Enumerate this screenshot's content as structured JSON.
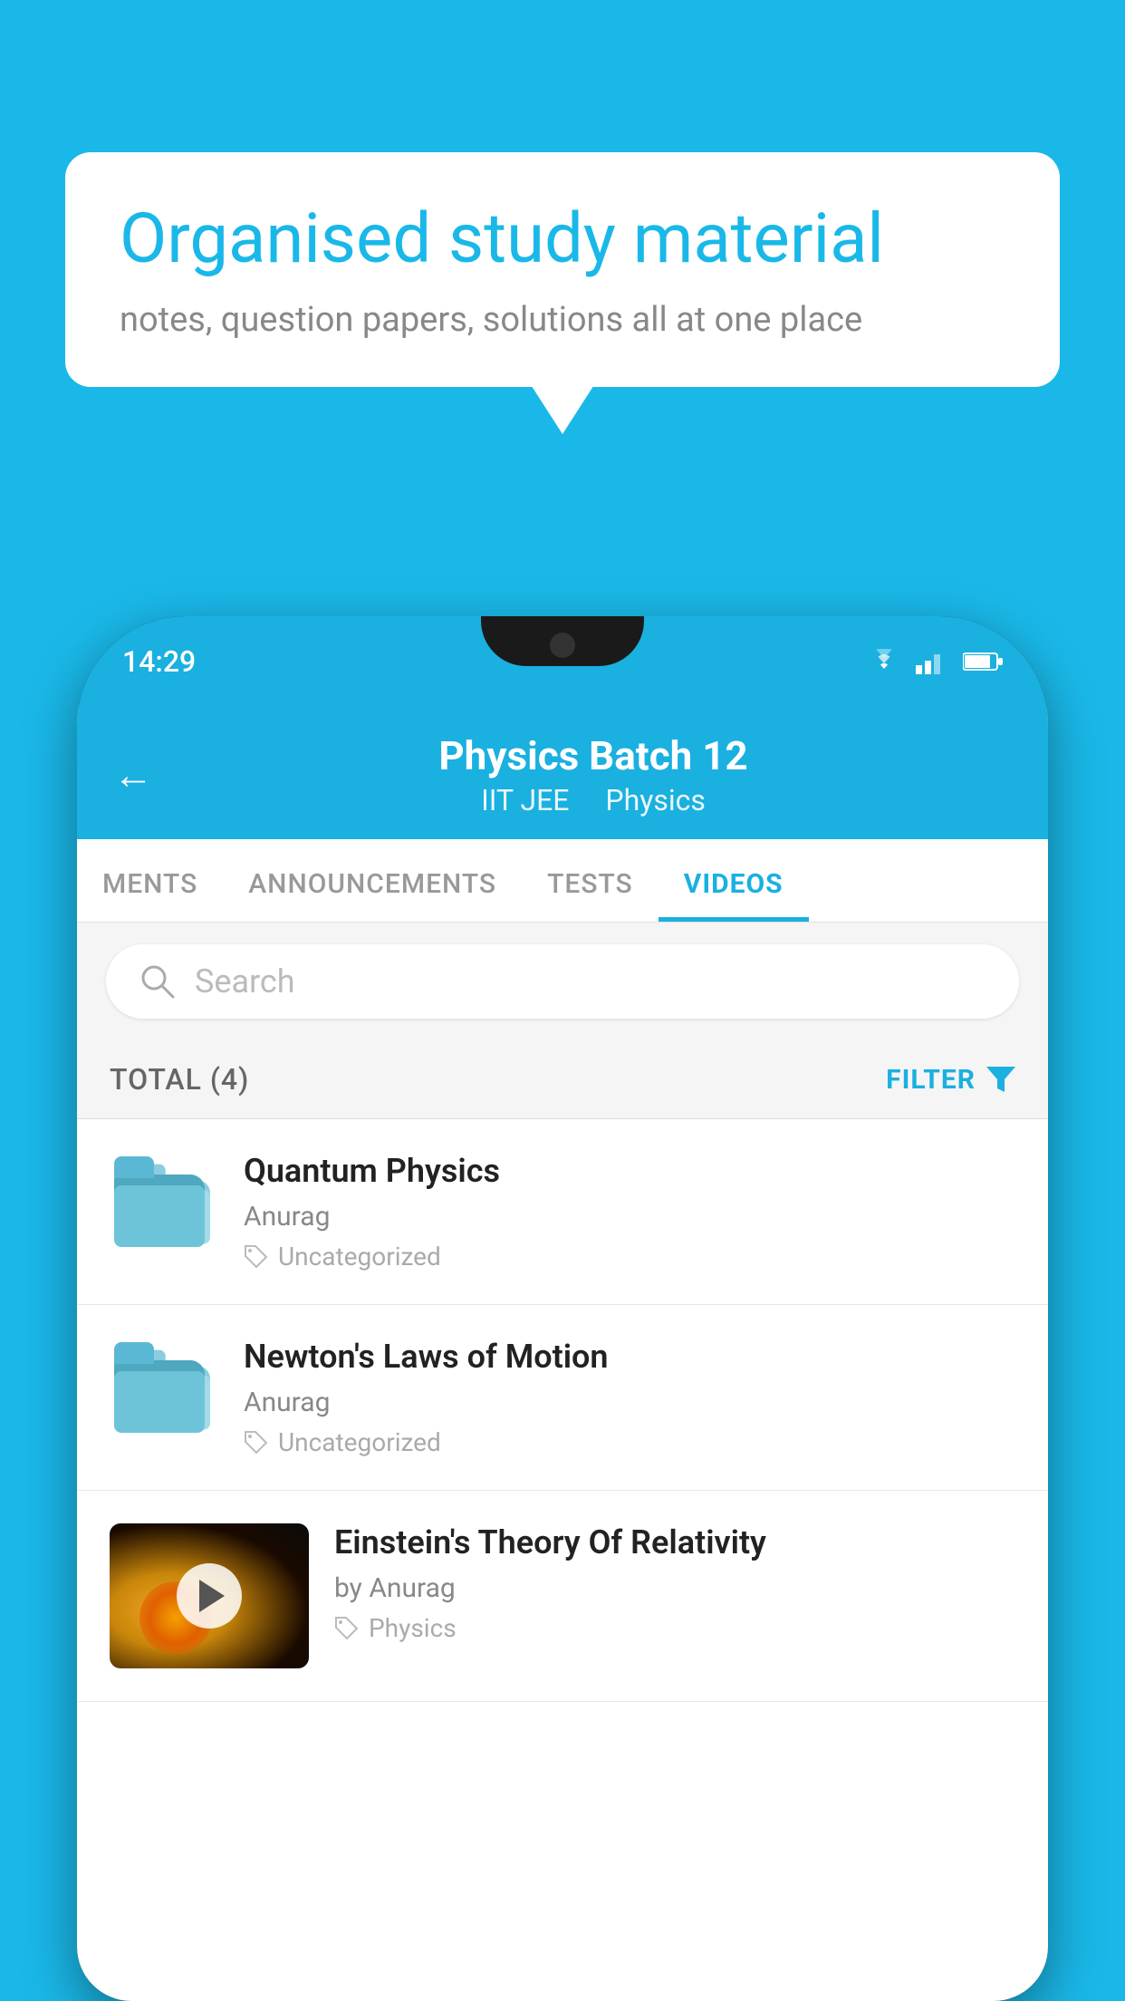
{
  "background_color": "#1ab8e8",
  "speech_bubble": {
    "title": "Organised study material",
    "subtitle": "notes, question papers, solutions all at one place"
  },
  "phone": {
    "status_bar": {
      "time": "14:29"
    },
    "header": {
      "back_label": "←",
      "title": "Physics Batch 12",
      "subtitle_part1": "IIT JEE",
      "subtitle_part2": "Physics"
    },
    "tabs": [
      {
        "label": "MENTS",
        "active": false
      },
      {
        "label": "ANNOUNCEMENTS",
        "active": false
      },
      {
        "label": "TESTS",
        "active": false
      },
      {
        "label": "VIDEOS",
        "active": true
      }
    ],
    "search": {
      "placeholder": "Search"
    },
    "filter_row": {
      "total_label": "TOTAL (4)",
      "filter_label": "FILTER"
    },
    "videos": [
      {
        "id": 1,
        "title": "Quantum Physics",
        "author": "Anurag",
        "tag": "Uncategorized",
        "type": "folder",
        "has_thumbnail": false
      },
      {
        "id": 2,
        "title": "Newton's Laws of Motion",
        "author": "Anurag",
        "tag": "Uncategorized",
        "type": "folder",
        "has_thumbnail": false
      },
      {
        "id": 3,
        "title": "Einstein's Theory Of Relativity",
        "author": "by Anurag",
        "tag": "Physics",
        "type": "video",
        "has_thumbnail": true
      }
    ]
  }
}
